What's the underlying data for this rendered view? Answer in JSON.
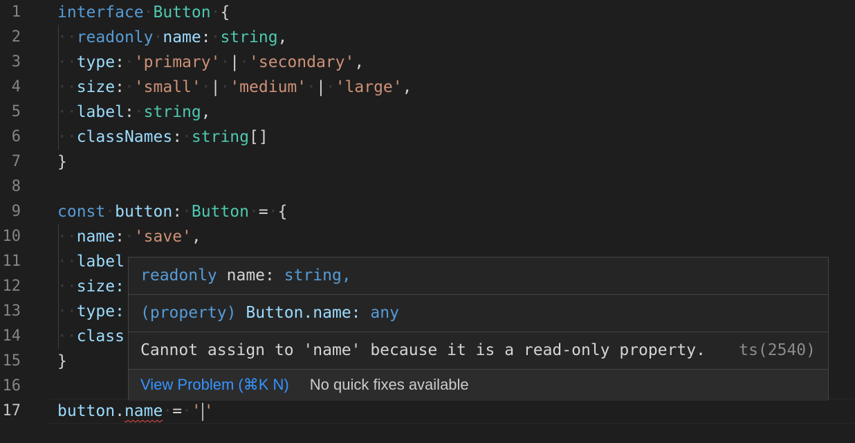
{
  "editor": {
    "line_numbers": [
      "1",
      "2",
      "3",
      "4",
      "5",
      "6",
      "7",
      "8",
      "9",
      "10",
      "11",
      "12",
      "13",
      "14",
      "15",
      "16",
      "17"
    ],
    "lines": {
      "l1": {
        "kw": "interface",
        "name": "Button",
        "brace": "{"
      },
      "l2": {
        "mod": "readonly",
        "prop": "name",
        "colon": ":",
        "type": "string",
        "comma": ","
      },
      "l3": {
        "prop": "type",
        "colon": ":",
        "s1": "'primary'",
        "bar": "|",
        "s2": "'secondary'",
        "comma": ","
      },
      "l4": {
        "prop": "size",
        "colon": ":",
        "s1": "'small'",
        "bar1": "|",
        "s2": "'medium'",
        "bar2": "|",
        "s3": "'large'",
        "comma": ","
      },
      "l5": {
        "prop": "label",
        "colon": ":",
        "type": "string",
        "comma": ","
      },
      "l6": {
        "prop": "classNames",
        "colon": ":",
        "type": "string",
        "brackets": "[]"
      },
      "l7": {
        "brace": "}"
      },
      "l9": {
        "kw": "const",
        "var": "button",
        "colon": ":",
        "type": "Button",
        "eq": "=",
        "brace": "{"
      },
      "l10": {
        "prop": "name",
        "colon": ":",
        "str": "'save'",
        "comma": ","
      },
      "l11": {
        "prop": "label"
      },
      "l12": {
        "prop": "size:"
      },
      "l13": {
        "prop": "type:"
      },
      "l14": {
        "prop": "class"
      },
      "l15": {
        "brace": "}"
      },
      "l17": {
        "var": "button",
        "dot": ".",
        "prop": "name",
        "eq": "=",
        "quote_open": "'",
        "quote_close": "'"
      }
    }
  },
  "hover": {
    "signature": {
      "kw": "readonly",
      "rest": "name:",
      "type": "string,"
    },
    "property": {
      "label": "(property)",
      "name": "Button.name:",
      "type": "any"
    },
    "error": {
      "message": "Cannot assign to 'name' because it is a read-only property.",
      "code": "ts(2540)"
    },
    "actions": {
      "view_problem": "View Problem (⌘K N)",
      "no_fixes": "No quick fixes available"
    }
  },
  "colors": {
    "background": "#1e1e1e",
    "keyword": "#569cd6",
    "type": "#4ec9b0",
    "variable": "#9cdcfe",
    "string": "#ce9178",
    "error": "#f14c4c",
    "link": "#3794ff"
  }
}
